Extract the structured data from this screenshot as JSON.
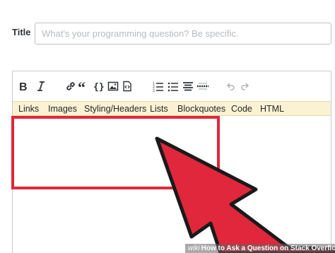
{
  "form": {
    "title_label": "Title",
    "title_placeholder": "What's your programming question? Be specific.",
    "title_value": ""
  },
  "toolbar": {
    "buttons": [
      {
        "name": "bold-icon"
      },
      {
        "name": "italic-icon"
      },
      {
        "name": "link-icon"
      },
      {
        "name": "blockquote-icon"
      },
      {
        "name": "code-icon"
      },
      {
        "name": "image-icon"
      },
      {
        "name": "snippet-icon"
      },
      {
        "name": "numbered-list-icon"
      },
      {
        "name": "bulleted-list-icon"
      },
      {
        "name": "heading-icon"
      },
      {
        "name": "horizontal-rule-icon"
      },
      {
        "name": "undo-icon"
      },
      {
        "name": "redo-icon"
      }
    ]
  },
  "help_tabs": [
    "Links",
    "Images",
    "Styling/Headers",
    "Lists",
    "Blockquotes",
    "Code",
    "HTML"
  ],
  "annotation": {
    "highlight_color": "#e0273b",
    "arrow_color": "#e0273b"
  },
  "watermark": {
    "brand": "wiki",
    "text": "How to Ask a Question on Stack Overflow"
  }
}
